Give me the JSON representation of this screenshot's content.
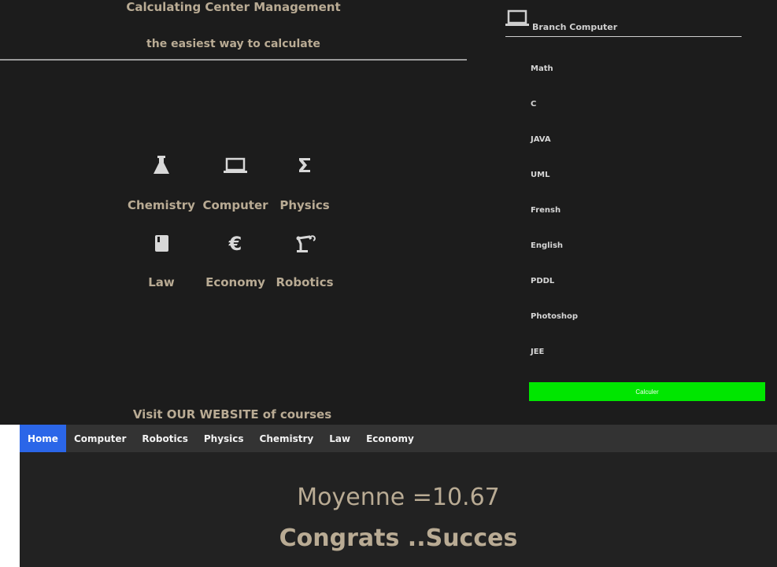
{
  "header": {
    "title": "Calculating Center Management",
    "subtitle": "the easiest way to calculate"
  },
  "branches": [
    {
      "label": "Chemistry",
      "icon": "flask-icon"
    },
    {
      "label": "Computer",
      "icon": "laptop-icon"
    },
    {
      "label": "Physics",
      "icon": "sigma-icon"
    },
    {
      "label": "Law",
      "icon": "book-icon"
    },
    {
      "label": "Economy",
      "icon": "euro-icon"
    },
    {
      "label": "Robotics",
      "icon": "robot-arm-icon"
    }
  ],
  "visit_text": "Visit OUR WEBSITE of courses",
  "panel": {
    "heading": "Branch Computer",
    "icon": "laptop-icon",
    "subjects": [
      "Math",
      "C",
      "JAVA",
      "UML",
      "Frensh",
      "English",
      "PDDL",
      "Photoshop",
      "JEE"
    ],
    "button_label": "Calculer",
    "button_color": "#00e600"
  },
  "nav": {
    "items": [
      "Home",
      "Computer",
      "Robotics",
      "Physics",
      "Chemistry",
      "Law",
      "Economy"
    ],
    "active": "Home",
    "active_color": "#2b66e8"
  },
  "result": {
    "moyenne": "Moyenne =10.67",
    "message": "Congrats ..Succes"
  }
}
